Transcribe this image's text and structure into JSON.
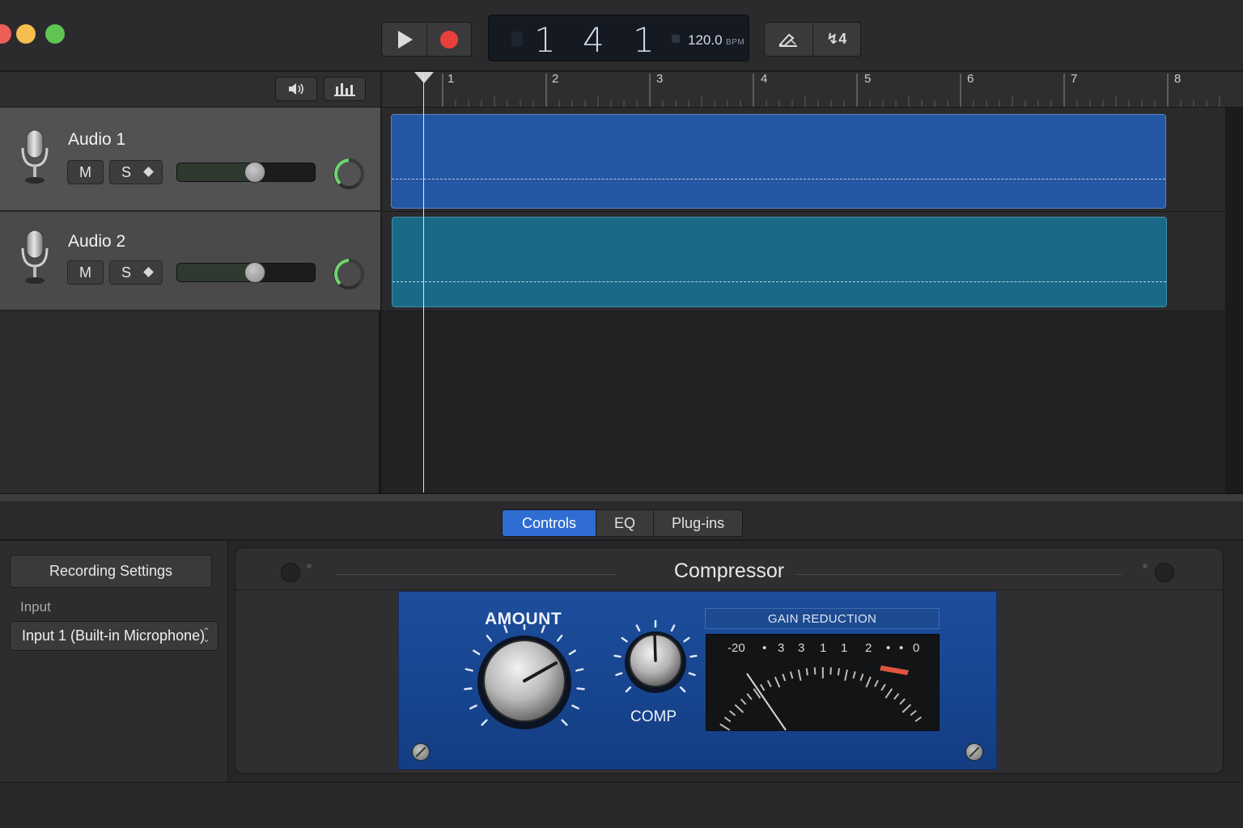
{
  "transport": {
    "play_icon": "play-icon",
    "record_icon": "record-icon",
    "bar": "1",
    "beat": "4",
    "division": "1",
    "tempo": "120.0",
    "tempo_unit": "BPM",
    "tools": [
      "pencil-icon",
      "tuner-icon"
    ],
    "count_in_label": "↯4"
  },
  "header_strip": {
    "buttons": [
      "speaker-icon",
      "equalizer-icon"
    ]
  },
  "tracks": [
    {
      "name": "Audio 1",
      "mute_label": "M",
      "solo_label": "S",
      "icon": "microphone-icon"
    },
    {
      "name": "Audio 2",
      "mute_label": "M",
      "solo_label": "S",
      "icon": "microphone-icon"
    }
  ],
  "ruler": {
    "bars": [
      "1",
      "2",
      "3",
      "4",
      "5",
      "6",
      "7",
      "8"
    ]
  },
  "colors": {
    "region_1": "#2457a3",
    "region_2": "#1a6987",
    "record": "#e83f3a",
    "tab_active": "#2f6dd2",
    "pan_green": "#6ed36b"
  },
  "smart_controls": {
    "tabs": [
      "Controls",
      "EQ",
      "Plug-ins"
    ],
    "active_tab": "Controls",
    "recording_settings_label": "Recording Settings",
    "input_label": "Input",
    "input_value": "Input 1 (Built-in Microphone)"
  },
  "plugin": {
    "title": "Compressor",
    "amount_label": "AMOUNT",
    "comp_label": "COMP",
    "gain_reduction_label": "GAIN REDUCTION",
    "meter_scale": [
      "-20",
      "•",
      "3",
      "3",
      "1",
      "1",
      "2",
      "•",
      "•",
      "0"
    ]
  }
}
